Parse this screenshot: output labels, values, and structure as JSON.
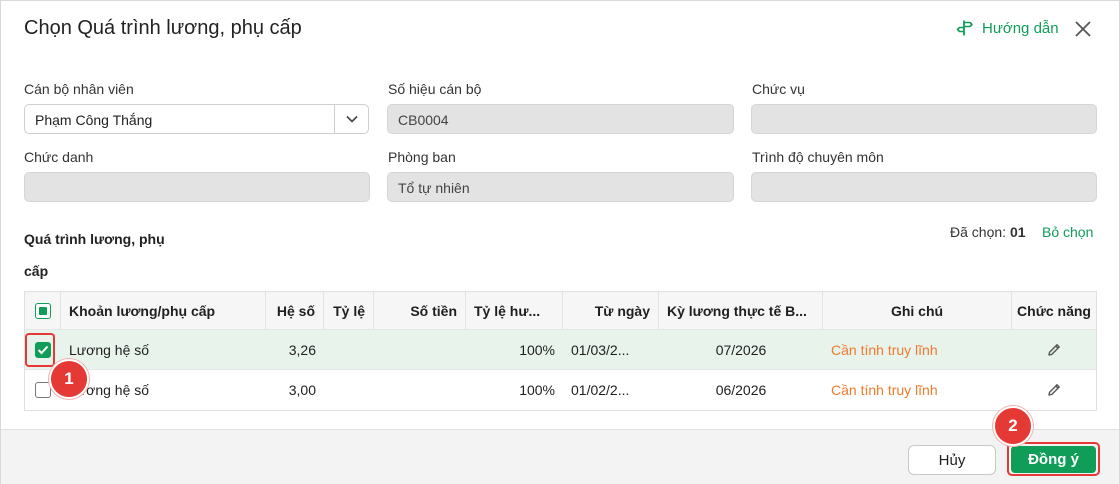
{
  "dialog": {
    "title": "Chọn Quá trình lương, phụ cấp",
    "help_label": "Hướng dẫn"
  },
  "fields": {
    "employee": {
      "label": "Cán bộ nhân viên",
      "value": "Phạm Công Thắng"
    },
    "staff_code": {
      "label": "Số hiệu cán bộ",
      "value": "CB0004"
    },
    "position": {
      "label": "Chức vụ",
      "value": ""
    },
    "title": {
      "label": "Chức danh",
      "value": ""
    },
    "department": {
      "label": "Phòng ban",
      "value": "Tổ tự nhiên"
    },
    "qualification": {
      "label": "Trình độ chuyên môn",
      "value": ""
    }
  },
  "section": {
    "title": "Quá trình lương, phụ cấp",
    "selected_prefix": "Đã chọn:",
    "selected_count": "01",
    "deselect_label": "Bỏ chọn"
  },
  "table": {
    "columns": [
      "Khoản lương/phụ cấp",
      "Hệ số",
      "Tỷ lệ",
      "Số tiền",
      "Tỷ lệ hư...",
      "Từ ngày",
      "Kỳ lương thực tế B...",
      "Ghi chú",
      "Chức năng"
    ],
    "rows": [
      {
        "checked": true,
        "item": "Lương hệ số",
        "coef": "3,26",
        "rate": "",
        "amount": "",
        "rate2": "100%",
        "from": "01/03/2...",
        "period": "07/2026",
        "note": "Cần tính truy lĩnh"
      },
      {
        "checked": false,
        "item": "Lương hệ số",
        "coef": "3,00",
        "rate": "",
        "amount": "",
        "rate2": "100%",
        "from": "01/02/2...",
        "period": "06/2026",
        "note": "Cần tính truy lĩnh"
      }
    ]
  },
  "footer": {
    "cancel_label": "Hủy",
    "ok_label": "Đồng ý"
  },
  "annotations": {
    "step1": "1",
    "step2": "2"
  },
  "colors": {
    "accent": "#0f9d58",
    "note": "#f07b2c",
    "highlight": "#e53935"
  },
  "icons": {
    "help": "signpost-icon",
    "close": "close-icon",
    "dropdown": "chevron-down-icon",
    "edit": "pencil-icon"
  }
}
